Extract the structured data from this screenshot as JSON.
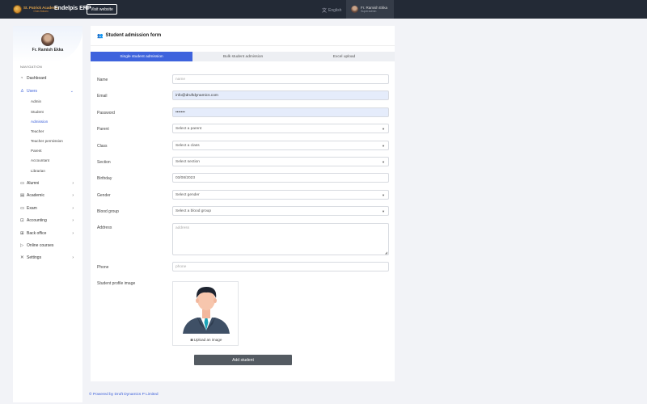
{
  "topbar": {
    "logo_line1": "St. Patrick Academy",
    "logo_line2": "Chas Bokaro",
    "app_title": "Endelpis ERP",
    "visit_label": "Visit website",
    "language": "English",
    "user_name": "Fr. Ramish Ekka",
    "user_role": "Superadmin"
  },
  "sidebar": {
    "user_name": "Fr. Ramish Ekka",
    "nav_heading": "NAVIGATION",
    "items": [
      {
        "label": "Dashboard",
        "icon": "dashboard-icon"
      },
      {
        "label": "Users",
        "icon": "user-icon"
      },
      {
        "label": "Alumni",
        "icon": "graduation-icon"
      },
      {
        "label": "Academic",
        "icon": "academic-icon"
      },
      {
        "label": "Exam",
        "icon": "exam-icon"
      },
      {
        "label": "Accounting",
        "icon": "accounting-icon"
      },
      {
        "label": "Back office",
        "icon": "office-icon"
      },
      {
        "label": "Online courses",
        "icon": "play-icon"
      },
      {
        "label": "Settings",
        "icon": "tools-icon"
      }
    ],
    "users_sub": [
      "Admin",
      "Student",
      "Admission",
      "Teacher",
      "Teacher permission",
      "Parent",
      "Accountant",
      "Librarian"
    ]
  },
  "form": {
    "title": "Student admission form",
    "tabs": [
      "Single student admission",
      "Bulk student admission",
      "Excel upload"
    ],
    "labels": {
      "name": "Name",
      "email": "Email",
      "password": "Password",
      "parent": "Parent",
      "class": "Class",
      "section": "Section",
      "birthday": "Birthday",
      "gender": "Gender",
      "blood_group": "Blood group",
      "address": "Address",
      "phone": "Phone",
      "profile_image": "Student profile image"
    },
    "placeholders": {
      "name": "name",
      "address": "address",
      "phone": "phone"
    },
    "values": {
      "email": "info@druftdynamics.com",
      "password": "•••••••",
      "parent": "Select a parent",
      "class": "Select a class",
      "section": "Select section",
      "birthday": "03/08/2023",
      "gender": "Select gender",
      "blood_group": "Select a blood group"
    },
    "upload_label": "Upload an image",
    "submit_label": "Add student"
  },
  "footer": {
    "text": "© Powered by Druft Dynamics P Limited"
  }
}
